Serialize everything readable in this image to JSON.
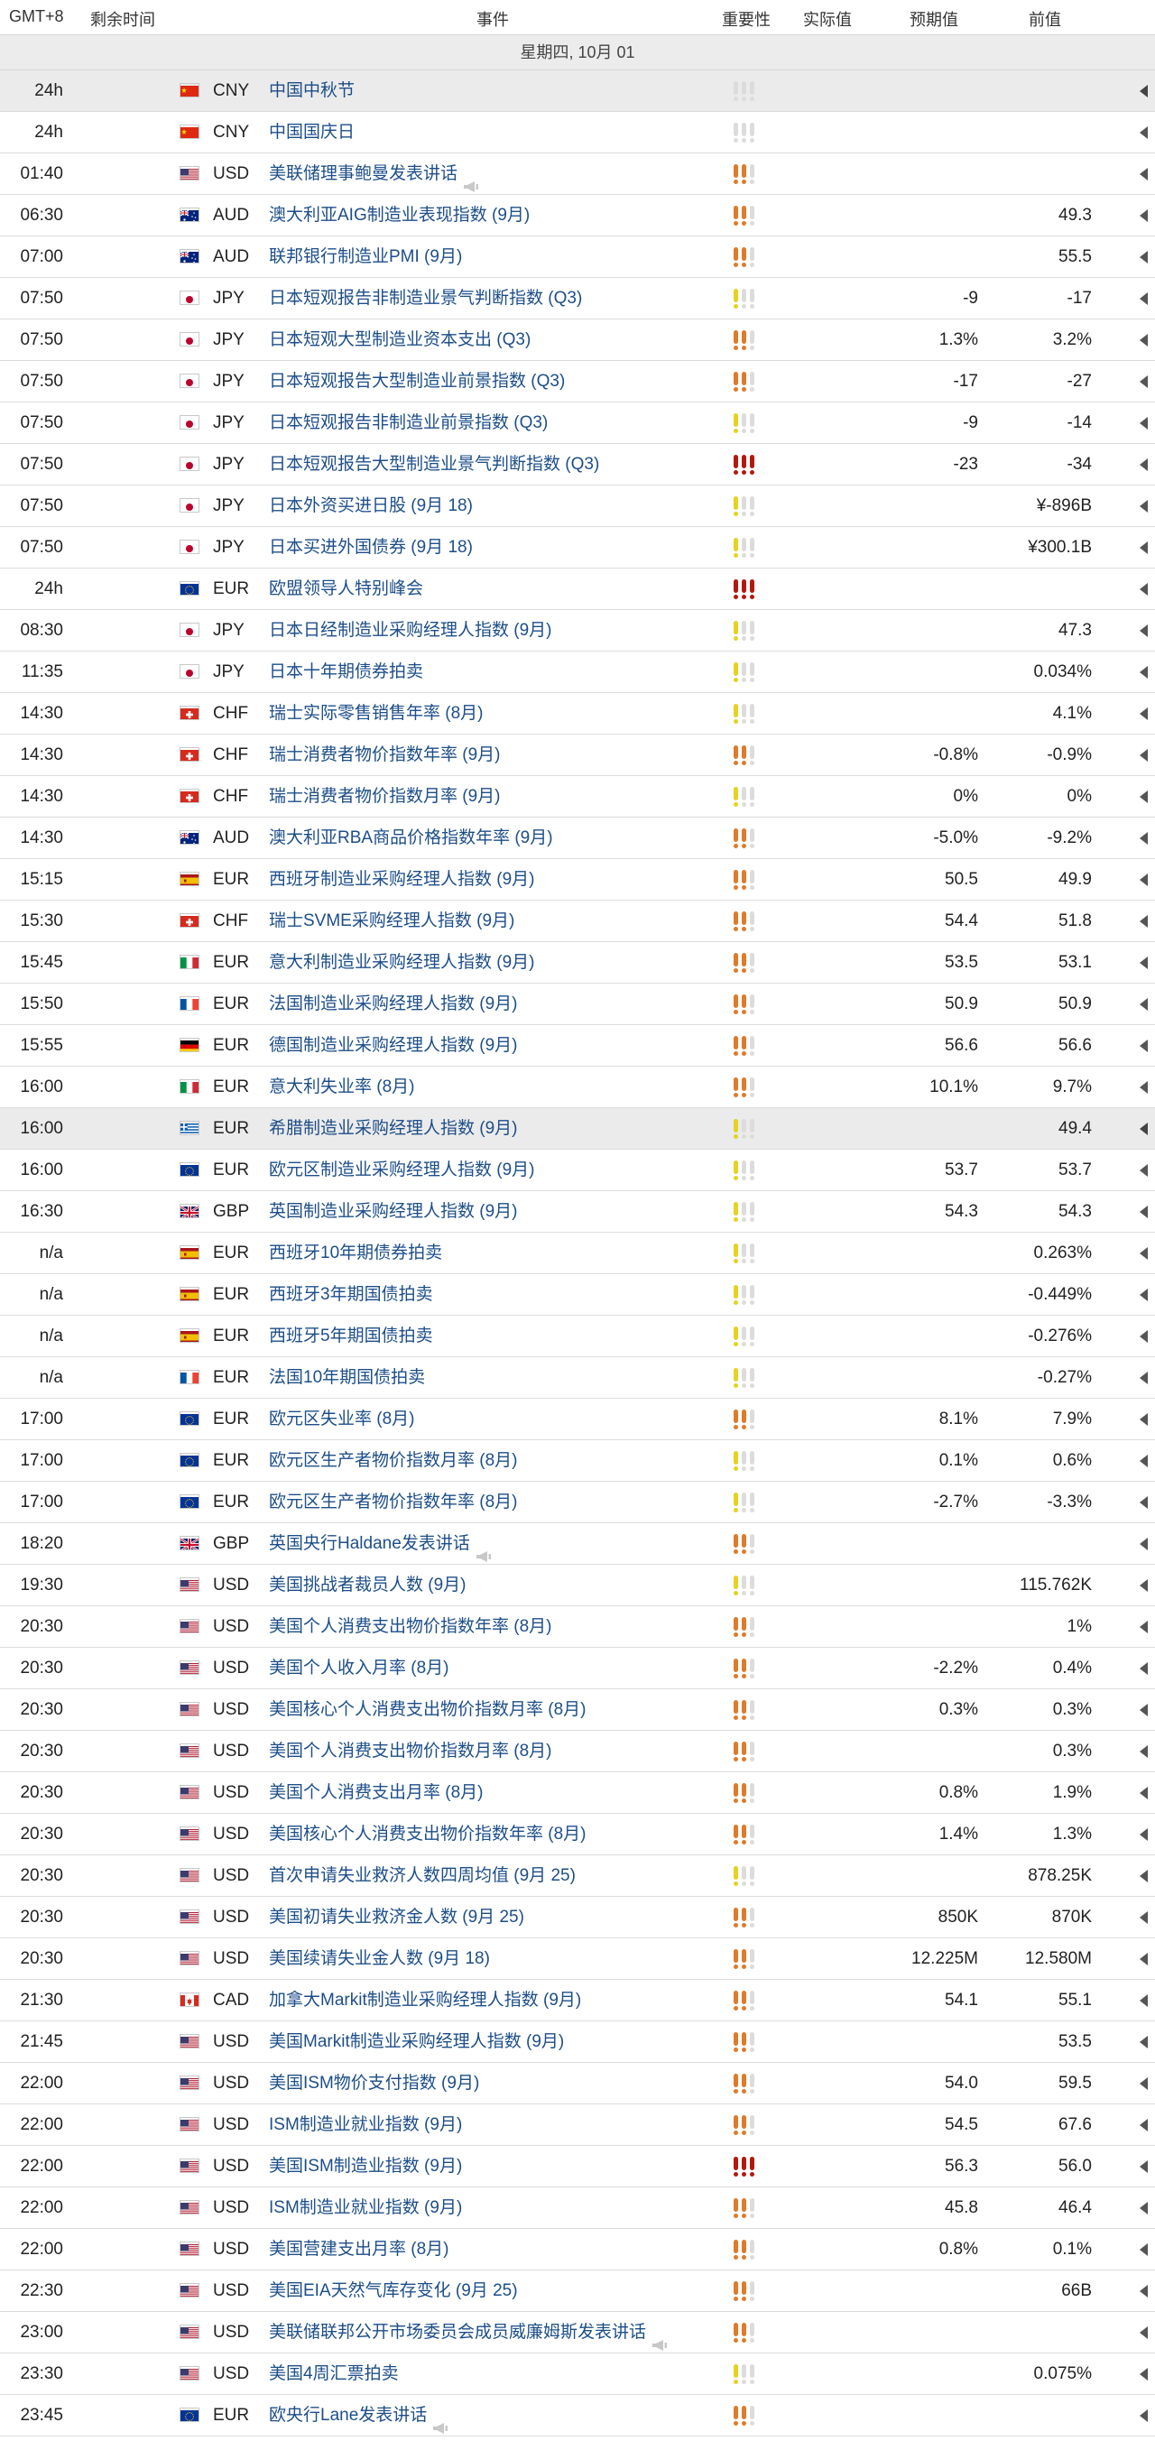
{
  "header": {
    "timezone": "GMT+8",
    "remaining": "剩余时间",
    "event": "事件",
    "importance": "重要性",
    "actual": "实际值",
    "forecast": "预期值",
    "previous": "前值"
  },
  "date_label": "星期四, 10月 01",
  "colors": {
    "high": "#b3180f",
    "medium": "#e07a28",
    "low": "#e6d21f",
    "inactive": "#dcdcdc",
    "event_text": "#1d4e89"
  },
  "rows": [
    {
      "time": "24h",
      "flag": "cn",
      "currency": "CNY",
      "event": "中国中秋节",
      "speech": false,
      "importance": 0,
      "forecast": "",
      "previous": "",
      "highlight": true,
      "arrow": "dark"
    },
    {
      "time": "24h",
      "flag": "cn",
      "currency": "CNY",
      "event": "中国国庆日",
      "speech": false,
      "importance": 0,
      "forecast": "",
      "previous": "",
      "highlight": false,
      "arrow": "dark"
    },
    {
      "time": "01:40",
      "flag": "us",
      "currency": "USD",
      "event": "美联储理事鲍曼发表讲话",
      "speech": true,
      "importance": 2,
      "forecast": "",
      "previous": "",
      "highlight": false,
      "arrow": "dark"
    },
    {
      "time": "06:30",
      "flag": "au",
      "currency": "AUD",
      "event": "澳大利亚AIG制造业表现指数 (9月)",
      "speech": false,
      "importance": 2,
      "forecast": "",
      "previous": "49.3",
      "highlight": false,
      "arrow": "dark"
    },
    {
      "time": "07:00",
      "flag": "au",
      "currency": "AUD",
      "event": "联邦银行制造业PMI (9月)",
      "speech": false,
      "importance": 2,
      "forecast": "",
      "previous": "55.5",
      "highlight": false,
      "arrow": "dark"
    },
    {
      "time": "07:50",
      "flag": "jp",
      "currency": "JPY",
      "event": "日本短观报告非制造业景气判断指数 (Q3)",
      "speech": false,
      "importance": 1,
      "forecast": "-9",
      "previous": "-17",
      "highlight": false,
      "arrow": "dark"
    },
    {
      "time": "07:50",
      "flag": "jp",
      "currency": "JPY",
      "event": "日本短观大型制造业资本支出 (Q3)",
      "speech": false,
      "importance": 2,
      "forecast": "1.3%",
      "previous": "3.2%",
      "highlight": false,
      "arrow": "dark"
    },
    {
      "time": "07:50",
      "flag": "jp",
      "currency": "JPY",
      "event": "日本短观报告大型制造业前景指数 (Q3)",
      "speech": false,
      "importance": 2,
      "forecast": "-17",
      "previous": "-27",
      "highlight": false,
      "arrow": "dark"
    },
    {
      "time": "07:50",
      "flag": "jp",
      "currency": "JPY",
      "event": "日本短观报告非制造业前景指数 (Q3)",
      "speech": false,
      "importance": 1,
      "forecast": "-9",
      "previous": "-14",
      "highlight": false,
      "arrow": "dark"
    },
    {
      "time": "07:50",
      "flag": "jp",
      "currency": "JPY",
      "event": "日本短观报告大型制造业景气判断指数 (Q3)",
      "speech": false,
      "importance": 3,
      "forecast": "-23",
      "previous": "-34",
      "highlight": false,
      "arrow": "dark"
    },
    {
      "time": "07:50",
      "flag": "jp",
      "currency": "JPY",
      "event": "日本外资买进日股 (9月 18)",
      "speech": false,
      "importance": 1,
      "forecast": "",
      "previous": "¥-896B",
      "highlight": false,
      "arrow": "dark"
    },
    {
      "time": "07:50",
      "flag": "jp",
      "currency": "JPY",
      "event": "日本买进外国债券 (9月 18)",
      "speech": false,
      "importance": 1,
      "forecast": "",
      "previous": "¥300.1B",
      "highlight": false,
      "arrow": "dark"
    },
    {
      "time": "24h",
      "flag": "eu",
      "currency": "EUR",
      "event": "欧盟领导人特别峰会",
      "speech": false,
      "importance": 3,
      "forecast": "",
      "previous": "",
      "highlight": false,
      "arrow": "dark"
    },
    {
      "time": "08:30",
      "flag": "jp",
      "currency": "JPY",
      "event": "日本日经制造业采购经理人指数 (9月)",
      "speech": false,
      "importance": 1,
      "forecast": "",
      "previous": "47.3",
      "highlight": false,
      "arrow": "dark"
    },
    {
      "time": "11:35",
      "flag": "jp",
      "currency": "JPY",
      "event": "日本十年期债券拍卖",
      "speech": false,
      "importance": 1,
      "forecast": "",
      "previous": "0.034%",
      "highlight": false,
      "arrow": "dark"
    },
    {
      "time": "14:30",
      "flag": "ch",
      "currency": "CHF",
      "event": "瑞士实际零售销售年率 (8月)",
      "speech": false,
      "importance": 1,
      "forecast": "",
      "previous": "4.1%",
      "highlight": false,
      "arrow": "dark"
    },
    {
      "time": "14:30",
      "flag": "ch",
      "currency": "CHF",
      "event": "瑞士消费者物价指数年率 (9月)",
      "speech": false,
      "importance": 2,
      "forecast": "-0.8%",
      "previous": "-0.9%",
      "highlight": false,
      "arrow": "dark"
    },
    {
      "time": "14:30",
      "flag": "ch",
      "currency": "CHF",
      "event": "瑞士消费者物价指数月率 (9月)",
      "speech": false,
      "importance": 1,
      "forecast": "0%",
      "previous": "0%",
      "highlight": false,
      "arrow": "dark"
    },
    {
      "time": "14:30",
      "flag": "au",
      "currency": "AUD",
      "event": "澳大利亚RBA商品价格指数年率 (9月)",
      "speech": false,
      "importance": 2,
      "forecast": "-5.0%",
      "previous": "-9.2%",
      "highlight": false,
      "arrow": "dark"
    },
    {
      "time": "15:15",
      "flag": "es",
      "currency": "EUR",
      "event": "西班牙制造业采购经理人指数 (9月)",
      "speech": false,
      "importance": 2,
      "forecast": "50.5",
      "previous": "49.9",
      "highlight": false,
      "arrow": "dark"
    },
    {
      "time": "15:30",
      "flag": "ch",
      "currency": "CHF",
      "event": "瑞士SVME采购经理人指数 (9月)",
      "speech": false,
      "importance": 2,
      "forecast": "54.4",
      "previous": "51.8",
      "highlight": false,
      "arrow": "dark"
    },
    {
      "time": "15:45",
      "flag": "it",
      "currency": "EUR",
      "event": "意大利制造业采购经理人指数 (9月)",
      "speech": false,
      "importance": 2,
      "forecast": "53.5",
      "previous": "53.1",
      "highlight": false,
      "arrow": "dark"
    },
    {
      "time": "15:50",
      "flag": "fr",
      "currency": "EUR",
      "event": "法国制造业采购经理人指数 (9月)",
      "speech": false,
      "importance": 2,
      "forecast": "50.9",
      "previous": "50.9",
      "highlight": false,
      "arrow": "dark"
    },
    {
      "time": "15:55",
      "flag": "de",
      "currency": "EUR",
      "event": "德国制造业采购经理人指数 (9月)",
      "speech": false,
      "importance": 2,
      "forecast": "56.6",
      "previous": "56.6",
      "highlight": false,
      "arrow": "dark"
    },
    {
      "time": "16:00",
      "flag": "it",
      "currency": "EUR",
      "event": "意大利失业率 (8月)",
      "speech": false,
      "importance": 2,
      "forecast": "10.1%",
      "previous": "9.7%",
      "highlight": false,
      "arrow": "dark"
    },
    {
      "time": "16:00",
      "flag": "gr",
      "currency": "EUR",
      "event": "希腊制造业采购经理人指数 (9月)",
      "speech": false,
      "importance": 1,
      "forecast": "",
      "previous": "49.4",
      "highlight": true,
      "arrow": "dark"
    },
    {
      "time": "16:00",
      "flag": "eu",
      "currency": "EUR",
      "event": "欧元区制造业采购经理人指数 (9月)",
      "speech": false,
      "importance": 1,
      "forecast": "53.7",
      "previous": "53.7",
      "highlight": false,
      "arrow": "dark"
    },
    {
      "time": "16:30",
      "flag": "gb",
      "currency": "GBP",
      "event": "英国制造业采购经理人指数 (9月)",
      "speech": false,
      "importance": 1,
      "forecast": "54.3",
      "previous": "54.3",
      "highlight": false,
      "arrow": "dark"
    },
    {
      "time": "n/a",
      "flag": "es",
      "currency": "EUR",
      "event": "西班牙10年期债券拍卖",
      "speech": false,
      "importance": 1,
      "forecast": "",
      "previous": "0.263%",
      "highlight": false,
      "arrow": "dark"
    },
    {
      "time": "n/a",
      "flag": "es",
      "currency": "EUR",
      "event": "西班牙3年期国债拍卖",
      "speech": false,
      "importance": 1,
      "forecast": "",
      "previous": "-0.449%",
      "highlight": false,
      "arrow": "dark"
    },
    {
      "time": "n/a",
      "flag": "es",
      "currency": "EUR",
      "event": "西班牙5年期国债拍卖",
      "speech": false,
      "importance": 1,
      "forecast": "",
      "previous": "-0.276%",
      "highlight": false,
      "arrow": "dark"
    },
    {
      "time": "n/a",
      "flag": "fr",
      "currency": "EUR",
      "event": "法国10年期国债拍卖",
      "speech": false,
      "importance": 1,
      "forecast": "",
      "previous": "-0.27%",
      "highlight": false,
      "arrow": "dark"
    },
    {
      "time": "17:00",
      "flag": "eu",
      "currency": "EUR",
      "event": "欧元区失业率 (8月)",
      "speech": false,
      "importance": 2,
      "forecast": "8.1%",
      "previous": "7.9%",
      "highlight": false,
      "arrow": "dark"
    },
    {
      "time": "17:00",
      "flag": "eu",
      "currency": "EUR",
      "event": "欧元区生产者物价指数月率 (8月)",
      "speech": false,
      "importance": 1,
      "forecast": "0.1%",
      "previous": "0.6%",
      "highlight": false,
      "arrow": "dark"
    },
    {
      "time": "17:00",
      "flag": "eu",
      "currency": "EUR",
      "event": "欧元区生产者物价指数年率 (8月)",
      "speech": false,
      "importance": 1,
      "forecast": "-2.7%",
      "previous": "-3.3%",
      "highlight": false,
      "arrow": "dark"
    },
    {
      "time": "18:20",
      "flag": "gb",
      "currency": "GBP",
      "event": "英国央行Haldane发表讲话",
      "speech": true,
      "importance": 2,
      "forecast": "",
      "previous": "",
      "highlight": false,
      "arrow": "dark"
    },
    {
      "time": "19:30",
      "flag": "us",
      "currency": "USD",
      "event": "美国挑战者裁员人数 (9月)",
      "speech": false,
      "importance": 1,
      "forecast": "",
      "previous": "115.762K",
      "highlight": false,
      "arrow": "dark"
    },
    {
      "time": "20:30",
      "flag": "us",
      "currency": "USD",
      "event": "美国个人消费支出物价指数年率 (8月)",
      "speech": false,
      "importance": 2,
      "forecast": "",
      "previous": "1%",
      "highlight": false,
      "arrow": "dark"
    },
    {
      "time": "20:30",
      "flag": "us",
      "currency": "USD",
      "event": "美国个人收入月率 (8月)",
      "speech": false,
      "importance": 2,
      "forecast": "-2.2%",
      "previous": "0.4%",
      "highlight": false,
      "arrow": "dark"
    },
    {
      "time": "20:30",
      "flag": "us",
      "currency": "USD",
      "event": "美国核心个人消费支出物价指数月率 (8月)",
      "speech": false,
      "importance": 2,
      "forecast": "0.3%",
      "previous": "0.3%",
      "highlight": false,
      "arrow": "dark"
    },
    {
      "time": "20:30",
      "flag": "us",
      "currency": "USD",
      "event": "美国个人消费支出物价指数月率 (8月)",
      "speech": false,
      "importance": 2,
      "forecast": "",
      "previous": "0.3%",
      "highlight": false,
      "arrow": "dark"
    },
    {
      "time": "20:30",
      "flag": "us",
      "currency": "USD",
      "event": "美国个人消费支出月率 (8月)",
      "speech": false,
      "importance": 2,
      "forecast": "0.8%",
      "previous": "1.9%",
      "highlight": false,
      "arrow": "dark"
    },
    {
      "time": "20:30",
      "flag": "us",
      "currency": "USD",
      "event": "美国核心个人消费支出物价指数年率 (8月)",
      "speech": false,
      "importance": 2,
      "forecast": "1.4%",
      "previous": "1.3%",
      "highlight": false,
      "arrow": "dark"
    },
    {
      "time": "20:30",
      "flag": "us",
      "currency": "USD",
      "event": "首次申请失业救济人数四周均值 (9月 25)",
      "speech": false,
      "importance": 1,
      "forecast": "",
      "previous": "878.25K",
      "highlight": false,
      "arrow": "dark"
    },
    {
      "time": "20:30",
      "flag": "us",
      "currency": "USD",
      "event": "美国初请失业救济金人数 (9月 25)",
      "speech": false,
      "importance": 2,
      "forecast": "850K",
      "previous": "870K",
      "highlight": false,
      "arrow": "dark"
    },
    {
      "time": "20:30",
      "flag": "us",
      "currency": "USD",
      "event": "美国续请失业金人数 (9月 18)",
      "speech": false,
      "importance": 2,
      "forecast": "12.225M",
      "previous": "12.580M",
      "highlight": false,
      "arrow": "dark"
    },
    {
      "time": "21:30",
      "flag": "ca",
      "currency": "CAD",
      "event": "加拿大Markit制造业采购经理人指数 (9月)",
      "speech": false,
      "importance": 2,
      "forecast": "54.1",
      "previous": "55.1",
      "highlight": false,
      "arrow": "dark"
    },
    {
      "time": "21:45",
      "flag": "us",
      "currency": "USD",
      "event": "美国Markit制造业采购经理人指数 (9月)",
      "speech": false,
      "importance": 2,
      "forecast": "",
      "previous": "53.5",
      "highlight": false,
      "arrow": "dark"
    },
    {
      "time": "22:00",
      "flag": "us",
      "currency": "USD",
      "event": "美国ISM物价支付指数 (9月)",
      "speech": false,
      "importance": 2,
      "forecast": "54.0",
      "previous": "59.5",
      "highlight": false,
      "arrow": "dark"
    },
    {
      "time": "22:00",
      "flag": "us",
      "currency": "USD",
      "event": "ISM制造业就业指数 (9月)",
      "speech": false,
      "importance": 2,
      "forecast": "54.5",
      "previous": "67.6",
      "highlight": false,
      "arrow": "dark"
    },
    {
      "time": "22:00",
      "flag": "us",
      "currency": "USD",
      "event": "美国ISM制造业指数 (9月)",
      "speech": false,
      "importance": 3,
      "forecast": "56.3",
      "previous": "56.0",
      "highlight": false,
      "arrow": "dark"
    },
    {
      "time": "22:00",
      "flag": "us",
      "currency": "USD",
      "event": "ISM制造业就业指数 (9月)",
      "speech": false,
      "importance": 2,
      "forecast": "45.8",
      "previous": "46.4",
      "highlight": false,
      "arrow": "dark"
    },
    {
      "time": "22:00",
      "flag": "us",
      "currency": "USD",
      "event": "美国营建支出月率 (8月)",
      "speech": false,
      "importance": 2,
      "forecast": "0.8%",
      "previous": "0.1%",
      "highlight": false,
      "arrow": "dark"
    },
    {
      "time": "22:30",
      "flag": "us",
      "currency": "USD",
      "event": "美国EIA天然气库存变化 (9月 25)",
      "speech": false,
      "importance": 2,
      "forecast": "",
      "previous": "66B",
      "highlight": false,
      "arrow": "dark"
    },
    {
      "time": "23:00",
      "flag": "us",
      "currency": "USD",
      "event": "美联储联邦公开市场委员会成员威廉姆斯发表讲话",
      "speech": true,
      "importance": 2,
      "forecast": "",
      "previous": "",
      "highlight": false,
      "arrow": "dark"
    },
    {
      "time": "23:30",
      "flag": "us",
      "currency": "USD",
      "event": "美国4周汇票拍卖",
      "speech": false,
      "importance": 1,
      "forecast": "",
      "previous": "0.075%",
      "highlight": false,
      "arrow": "dark"
    },
    {
      "time": "23:45",
      "flag": "eu",
      "currency": "EUR",
      "event": "欧央行Lane发表讲话",
      "speech": true,
      "importance": 2,
      "forecast": "",
      "previous": "",
      "highlight": false,
      "arrow": "dark"
    }
  ]
}
